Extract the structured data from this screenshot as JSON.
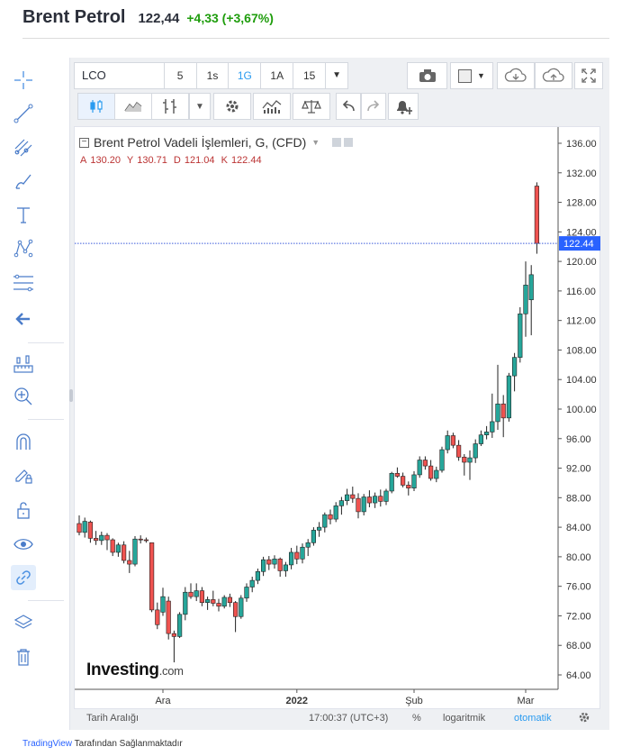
{
  "header": {
    "title": "Brent Petrol",
    "price": "122,44",
    "change": "+4,33 (+3,67%)"
  },
  "toolbar": {
    "symbol": "LCO",
    "intervals": [
      {
        "label": "5",
        "selected": false
      },
      {
        "label": "1s",
        "selected": false
      },
      {
        "label": "1G",
        "selected": true
      },
      {
        "label": "1A",
        "selected": false
      },
      {
        "label": "15",
        "selected": false
      }
    ],
    "icons": [
      "camera-icon",
      "color-square-icon",
      "cloud-download-icon",
      "cloud-upload-icon",
      "fullscreen-icon"
    ]
  },
  "toolbar2": {
    "icons": [
      "candles-icon",
      "area-chart-icon",
      "compare-icon",
      "settings-icon",
      "indicators-icon",
      "scale-icon",
      "undo-icon",
      "redo-icon",
      "alert-icon"
    ]
  },
  "left_toolbar": {
    "icons": [
      "crosshair-icon",
      "trend-line-icon",
      "pitchfork-icon",
      "brush-icon",
      "text-icon",
      "pattern-icon",
      "fib-icon",
      "back-arrow-icon",
      "measure-icon",
      "zoom-in-icon",
      "magnet-icon",
      "lock-draw-icon",
      "unlock-icon",
      "eye-icon",
      "link-icon",
      "layers-icon",
      "trash-icon"
    ]
  },
  "legend": {
    "title": "Brent Petrol Vadeli İşlemleri, G, (CFD)",
    "open_label": "A",
    "open": "130.20",
    "high_label": "Y",
    "high": "130.71",
    "low_label": "D",
    "low": "121.04",
    "close_label": "K",
    "close": "122.44"
  },
  "logo": {
    "brand": "Investing",
    "suffix": ".com"
  },
  "bottom": {
    "range": "Tarih Aralığı",
    "time": "17:00:37 (UTC+3)",
    "percent": "%",
    "log": "logaritmik",
    "auto": "otomatik"
  },
  "footer": {
    "brand": "TradingView",
    "text": "Tarafından Sağlanmaktadır"
  },
  "colors": {
    "up": "#26a69a",
    "down": "#ef5350",
    "accent": "#2962ff",
    "change": "#1f9d0d"
  },
  "chart_data": {
    "type": "candlestick",
    "title": "Brent Petrol Vadeli İşlemleri, G, (CFD)",
    "ylim": [
      62,
      138
    ],
    "y_ticks": [
      64,
      68,
      72,
      76,
      80,
      84,
      88,
      92,
      96,
      100,
      104,
      108,
      112,
      116,
      120,
      124,
      128,
      132,
      136
    ],
    "y_tick_labels": [
      "64.00",
      "68.00",
      "72.00",
      "76.00",
      "80.00",
      "84.00",
      "88.00",
      "92.00",
      "96.00",
      "100.00",
      "104.00",
      "108.00",
      "112.00",
      "116.00",
      "120.00",
      "124.00",
      "128.00",
      "132.00",
      "136.00"
    ],
    "x_labels": [
      {
        "label": "Ara",
        "index": 15
      },
      {
        "label": "2022",
        "index": 39
      },
      {
        "label": "Şub",
        "index": 60
      },
      {
        "label": "Mar",
        "index": 80
      }
    ],
    "last_price": 122.44,
    "last_price_label": "122.44",
    "candles": [
      [
        84.5,
        85.6,
        82.9,
        83.3
      ],
      [
        83.3,
        85.3,
        82.6,
        84.8
      ],
      [
        84.7,
        84.9,
        81.9,
        82.5
      ],
      [
        82.5,
        83.5,
        81.6,
        82.2
      ],
      [
        82.2,
        83.4,
        81.6,
        82.9
      ],
      [
        82.9,
        83.2,
        80.9,
        82.3
      ],
      [
        82.3,
        82.5,
        80.1,
        80.6
      ],
      [
        80.6,
        81.9,
        80.0,
        81.6
      ],
      [
        81.6,
        82.1,
        79.1,
        79.5
      ],
      [
        79.5,
        80.8,
        77.8,
        79.0
      ],
      [
        79.0,
        82.8,
        78.7,
        82.4
      ],
      [
        82.4,
        82.9,
        81.8,
        82.3
      ],
      [
        82.3,
        82.6,
        81.9,
        82.2
      ],
      [
        81.9,
        81.6,
        72.5,
        72.8
      ],
      [
        72.8,
        73.8,
        70.2,
        70.8
      ],
      [
        72.5,
        75.8,
        72.0,
        74.6
      ],
      [
        74.0,
        74.6,
        68.8,
        69.6
      ],
      [
        69.6,
        70.0,
        65.7,
        69.2
      ],
      [
        69.2,
        72.5,
        69.0,
        72.2
      ],
      [
        72.2,
        75.9,
        71.4,
        75.2
      ],
      [
        75.2,
        76.4,
        74.3,
        74.6
      ],
      [
        74.6,
        76.4,
        74.0,
        75.4
      ],
      [
        75.4,
        75.9,
        73.3,
        73.8
      ],
      [
        73.8,
        74.6,
        72.8,
        74.2
      ],
      [
        74.2,
        75.4,
        73.3,
        73.7
      ],
      [
        73.7,
        74.3,
        72.6,
        73.3
      ],
      [
        73.3,
        74.8,
        73.0,
        74.5
      ],
      [
        74.5,
        75.0,
        73.2,
        73.8
      ],
      [
        73.8,
        74.0,
        69.8,
        71.9
      ],
      [
        71.9,
        74.8,
        71.6,
        74.4
      ],
      [
        74.4,
        76.4,
        73.9,
        75.9
      ],
      [
        75.9,
        77.3,
        75.2,
        76.8
      ],
      [
        76.8,
        78.4,
        76.3,
        78.0
      ],
      [
        78.0,
        80.0,
        77.4,
        79.6
      ],
      [
        79.6,
        80.1,
        78.2,
        79.0
      ],
      [
        79.0,
        80.2,
        78.4,
        79.7
      ],
      [
        79.7,
        79.9,
        77.3,
        78.1
      ],
      [
        78.1,
        79.3,
        77.3,
        78.9
      ],
      [
        78.9,
        81.2,
        78.3,
        80.6
      ],
      [
        80.6,
        81.5,
        79.0,
        79.7
      ],
      [
        79.7,
        81.8,
        79.1,
        81.3
      ],
      [
        81.3,
        82.4,
        80.1,
        81.9
      ],
      [
        81.9,
        84.0,
        81.5,
        83.6
      ],
      [
        83.6,
        84.7,
        82.7,
        84.0
      ],
      [
        84.0,
        86.0,
        83.3,
        85.7
      ],
      [
        85.7,
        86.4,
        84.4,
        85.1
      ],
      [
        85.1,
        87.4,
        84.7,
        86.9
      ],
      [
        86.9,
        88.1,
        85.7,
        87.6
      ],
      [
        87.6,
        89.2,
        87.0,
        88.4
      ],
      [
        88.4,
        89.5,
        87.3,
        87.9
      ],
      [
        87.9,
        88.6,
        85.2,
        86.1
      ],
      [
        86.1,
        88.5,
        85.6,
        88.1
      ],
      [
        88.1,
        89.0,
        86.7,
        87.3
      ],
      [
        87.3,
        88.7,
        86.6,
        88.2
      ],
      [
        88.2,
        89.1,
        86.8,
        87.5
      ],
      [
        87.5,
        89.2,
        87.0,
        88.9
      ],
      [
        88.9,
        91.5,
        88.6,
        91.3
      ],
      [
        91.3,
        92.1,
        90.7,
        90.9
      ],
      [
        90.9,
        91.4,
        89.4,
        89.7
      ],
      [
        89.7,
        90.2,
        88.3,
        89.3
      ],
      [
        89.3,
        91.6,
        88.9,
        91.1
      ],
      [
        91.1,
        93.6,
        90.7,
        93.1
      ],
      [
        93.1,
        93.6,
        91.8,
        92.3
      ],
      [
        92.3,
        93.1,
        90.3,
        90.6
      ],
      [
        90.6,
        92.2,
        90.1,
        91.7
      ],
      [
        91.7,
        94.9,
        91.4,
        94.5
      ],
      [
        94.5,
        97.1,
        94.0,
        96.4
      ],
      [
        96.4,
        96.8,
        94.7,
        95.1
      ],
      [
        95.1,
        95.8,
        93.0,
        93.5
      ],
      [
        93.5,
        93.9,
        91.0,
        92.8
      ],
      [
        92.8,
        94.4,
        90.4,
        93.4
      ],
      [
        93.4,
        95.9,
        92.7,
        95.3
      ],
      [
        95.3,
        97.1,
        95.0,
        96.5
      ],
      [
        96.5,
        97.7,
        95.9,
        96.9
      ],
      [
        96.9,
        102.1,
        96.1,
        98.3
      ],
      [
        98.3,
        106.0,
        97.2,
        100.7
      ],
      [
        100.7,
        101.9,
        96.2,
        98.8
      ],
      [
        98.8,
        104.9,
        98.3,
        104.5
      ],
      [
        104.5,
        107.6,
        102.4,
        107.0
      ],
      [
        107.0,
        113.8,
        106.3,
        112.9
      ],
      [
        112.9,
        120.0,
        109.8,
        116.8
      ],
      [
        114.8,
        119.5,
        110.0,
        118.2
      ],
      [
        130.2,
        130.71,
        121.04,
        122.44
      ]
    ]
  }
}
